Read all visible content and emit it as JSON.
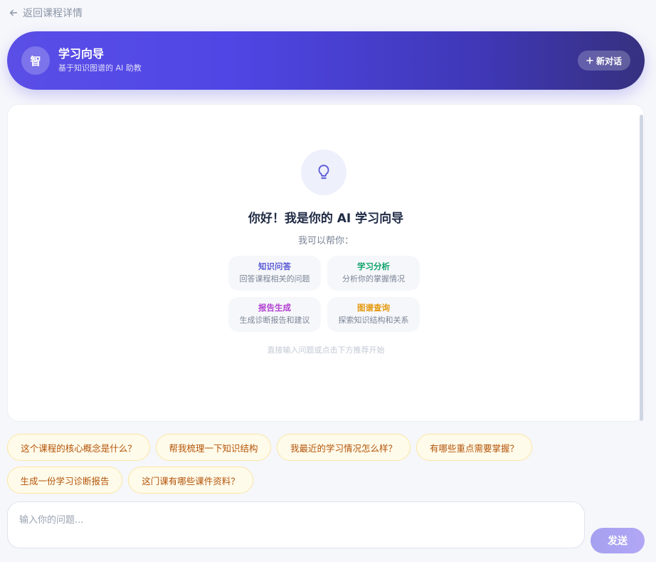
{
  "nav": {
    "back_label": "返回课程详情"
  },
  "header": {
    "avatar_text": "智",
    "title": "学习向导",
    "subtitle": "基于知识图谱的 AI 助教",
    "new_chat_label": "新对话",
    "accent_color": "#4f46e5"
  },
  "welcome": {
    "icon": "lightbulb-icon",
    "title": "你好！我是你的 AI 学习向导",
    "subtitle": "我可以帮你：",
    "hint": "直接输入问题或点击下方推荐开始",
    "features": [
      {
        "title": "知识问答",
        "desc": "回答课程相关的问题",
        "color": "#5b5bd6"
      },
      {
        "title": "学习分析",
        "desc": "分析你的掌握情况",
        "color": "#10a36b"
      },
      {
        "title": "报告生成",
        "desc": "生成诊断报告和建议",
        "color": "#b13fd1"
      },
      {
        "title": "图谱查询",
        "desc": "探索知识结构和关系",
        "color": "#e49b12"
      }
    ]
  },
  "suggestions": [
    "这个课程的核心概念是什么？",
    "帮我梳理一下知识结构",
    "我最近的学习情况怎么样？",
    "有哪些重点需要掌握？",
    "生成一份学习诊断报告",
    "这门课有哪些课件资料？"
  ],
  "composer": {
    "placeholder": "输入你的问题...",
    "send_label": "发送"
  }
}
